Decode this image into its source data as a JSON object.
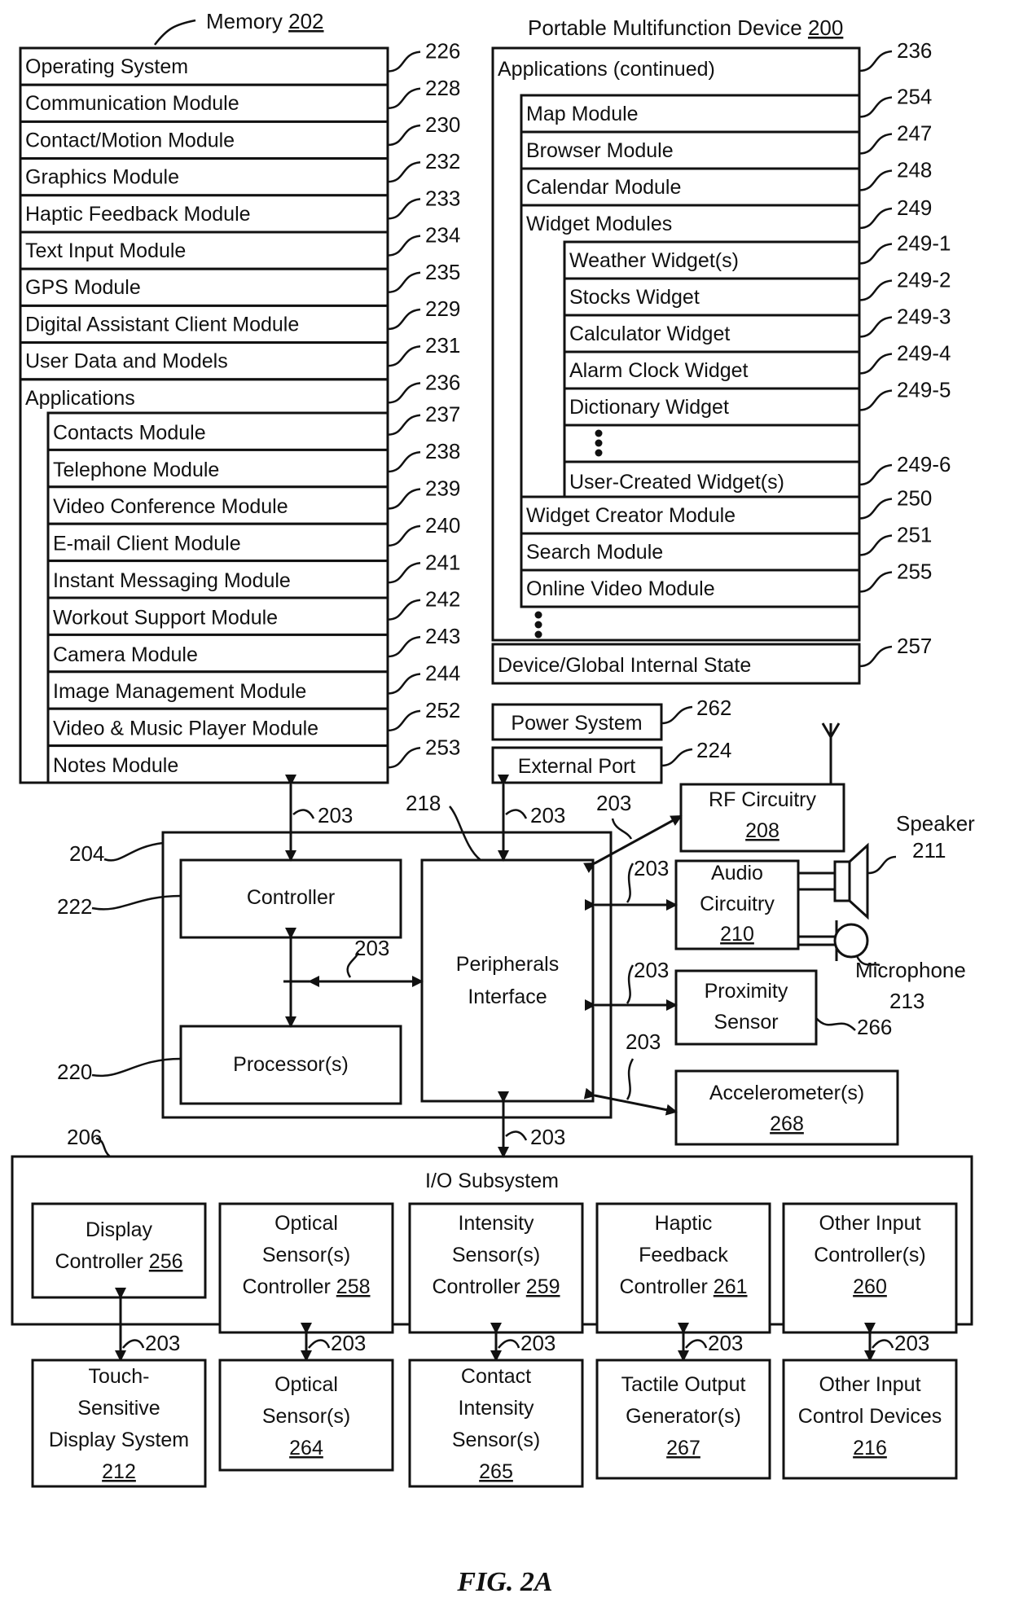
{
  "memory": {
    "title": "Memory",
    "ref": "202",
    "rows": [
      {
        "label": "Operating System",
        "ref": "226"
      },
      {
        "label": "Communication Module",
        "ref": "228"
      },
      {
        "label": "Contact/Motion Module",
        "ref": "230"
      },
      {
        "label": "Graphics Module",
        "ref": "232"
      },
      {
        "label": "Haptic Feedback Module",
        "ref": "233"
      },
      {
        "label": "Text Input Module",
        "ref": "234"
      },
      {
        "label": "GPS Module",
        "ref": "235"
      },
      {
        "label": "Digital Assistant Client Module",
        "ref": "229"
      },
      {
        "label": "User Data and Models",
        "ref": "231"
      },
      {
        "label": "Applications",
        "ref": "236"
      }
    ],
    "applications": [
      {
        "label": "Contacts Module",
        "ref": "237"
      },
      {
        "label": "Telephone Module",
        "ref": "238"
      },
      {
        "label": "Video Conference Module",
        "ref": "239"
      },
      {
        "label": "E-mail Client Module",
        "ref": "240"
      },
      {
        "label": "Instant Messaging Module",
        "ref": "241"
      },
      {
        "label": "Workout Support Module",
        "ref": "242"
      },
      {
        "label": "Camera Module",
        "ref": "243"
      },
      {
        "label": "Image Management Module",
        "ref": "244"
      },
      {
        "label": "Video & Music Player Module",
        "ref": "252"
      },
      {
        "label": "Notes Module",
        "ref": "253"
      }
    ]
  },
  "device": {
    "title": "Portable Multifunction Device",
    "ref": "200",
    "apps_continued": {
      "label": "Applications (continued)",
      "ref": "236"
    },
    "modules_top": [
      {
        "label": "Map Module",
        "ref": "254"
      },
      {
        "label": "Browser Module",
        "ref": "247"
      },
      {
        "label": "Calendar Module",
        "ref": "248"
      }
    ],
    "widget_modules": {
      "label": "Widget Modules",
      "ref": "249"
    },
    "widgets": [
      {
        "label": "Weather Widget(s)",
        "ref": "249-1"
      },
      {
        "label": "Stocks Widget",
        "ref": "249-2"
      },
      {
        "label": "Calculator Widget",
        "ref": "249-3"
      },
      {
        "label": "Alarm Clock Widget",
        "ref": "249-4"
      },
      {
        "label": "Dictionary Widget",
        "ref": "249-5"
      }
    ],
    "user_created_widget": {
      "label": "User-Created Widget(s)",
      "ref": "249-6"
    },
    "modules_bottom": [
      {
        "label": "Widget Creator Module",
        "ref": "250"
      },
      {
        "label": "Search Module",
        "ref": "251"
      },
      {
        "label": "Online Video Module",
        "ref": "255"
      }
    ],
    "global_state": {
      "label": "Device/Global Internal State",
      "ref": "257"
    }
  },
  "power_system": {
    "label": "Power System",
    "ref": "262"
  },
  "external_port": {
    "label": "External Port",
    "ref": "224"
  },
  "rf_circuitry": {
    "label": "RF Circuitry",
    "ref": "208"
  },
  "audio_circuitry": {
    "line1": "Audio",
    "line2": "Circuitry",
    "ref": "210"
  },
  "speaker": {
    "label": "Speaker",
    "ref": "211"
  },
  "microphone": {
    "label": "Microphone",
    "ref": "213"
  },
  "proximity_sensor": {
    "line1": "Proximity",
    "line2": "Sensor",
    "ref": "266"
  },
  "accelerometer": {
    "label": "Accelerometer(s)",
    "ref": "268"
  },
  "chip": {
    "ref": "204",
    "controller": {
      "label": "Controller",
      "ref": "222"
    },
    "processor": {
      "label": "Processor(s)",
      "ref": "220"
    },
    "peripherals": {
      "line1": "Peripherals",
      "line2": "Interface",
      "ref": "218"
    }
  },
  "bus_ref": "203",
  "io_subsystem": {
    "label": "I/O Subsystem",
    "ref": "206",
    "controllers": [
      {
        "lines": [
          "Display",
          "Controller"
        ],
        "ref": "256"
      },
      {
        "lines": [
          "Optical",
          "Sensor(s)",
          "Controller"
        ],
        "ref": "258"
      },
      {
        "lines": [
          "Intensity",
          "Sensor(s)",
          "Controller"
        ],
        "ref": "259"
      },
      {
        "lines": [
          "Haptic",
          "Feedback",
          "Controller"
        ],
        "ref": "261"
      },
      {
        "lines": [
          "Other Input",
          "Controller(s)"
        ],
        "ref": "260"
      }
    ]
  },
  "devices": [
    {
      "lines": [
        "Touch-",
        "Sensitive",
        "Display System"
      ],
      "ref": "212"
    },
    {
      "lines": [
        "Optical",
        "Sensor(s)"
      ],
      "ref": "264"
    },
    {
      "lines": [
        "Contact",
        "Intensity",
        "Sensor(s)"
      ],
      "ref": "265"
    },
    {
      "lines": [
        "Tactile Output",
        "Generator(s)"
      ],
      "ref": "267"
    },
    {
      "lines": [
        "Other Input",
        "Control Devices"
      ],
      "ref": "216"
    }
  ],
  "figure_label": "FIG. 2A"
}
